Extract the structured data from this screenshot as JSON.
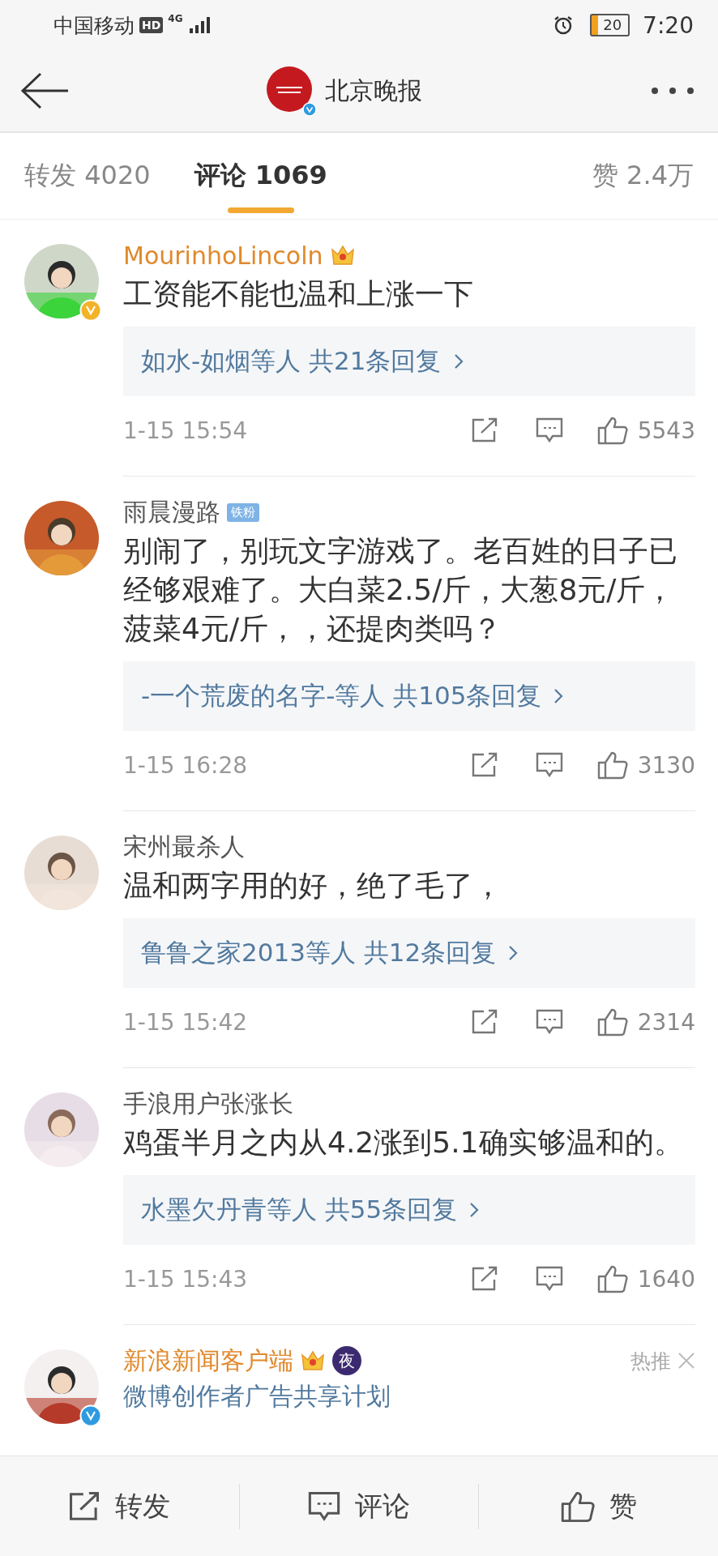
{
  "status_bar": {
    "carrier": "中国移动",
    "hd": "HD",
    "network": "4G",
    "battery": "20",
    "time": "7:20"
  },
  "header": {
    "title": "北京晚报"
  },
  "tabs": [
    {
      "label": "转发 4020",
      "selected": false
    },
    {
      "label": "评论 1069",
      "selected": true
    },
    {
      "label": "赞 2.4万",
      "selected": false
    }
  ],
  "comments": [
    {
      "name": "MourinhoLincoln",
      "vip": true,
      "verified": {
        "color": "#f2b32a"
      },
      "badges": [
        {
          "kind": "crown"
        }
      ],
      "text": "工资能不能也温和上涨一下",
      "replies": "如水-如烟等人 共21条回复",
      "time": "1-15 15:54",
      "likes": "5543"
    },
    {
      "name": "雨晨漫路",
      "vip": false,
      "badges": [
        {
          "kind": "fan",
          "text": "铁粉"
        }
      ],
      "text": "别闹了，别玩文字游戏了。老百姓的日子已经够艰难了。大白菜2.5/斤，大葱8元/斤，菠菜4元/斤，，还提肉类吗？",
      "replies": "-一个荒废的名字-等人 共105条回复",
      "time": "1-15 16:28",
      "likes": "3130"
    },
    {
      "name": "宋州最杀人",
      "vip": false,
      "text": "温和两字用的好，绝了毛了，",
      "replies": "鲁鲁之家2013等人 共12条回复",
      "time": "1-15 15:42",
      "likes": "2314"
    },
    {
      "name": "手浪用户张涨长",
      "vip": false,
      "text": "鸡蛋半月之内从4.2涨到5.1确实够温和的。",
      "replies": "水墨欠丹青等人 共55条回复",
      "time": "1-15 15:43",
      "likes": "1640"
    },
    {
      "name": "新浪新闻客户端",
      "vip": true,
      "verified": {
        "color": "#2e9be0"
      },
      "badges": [
        {
          "kind": "crown"
        },
        {
          "kind": "night",
          "text": "夜"
        }
      ],
      "subtitle": "微博创作者广告共享计划",
      "tag": "热推"
    }
  ],
  "bottom_bar": [
    {
      "kind": "share",
      "label": "转发"
    },
    {
      "kind": "comment",
      "label": "评论"
    },
    {
      "kind": "like",
      "label": "赞"
    }
  ]
}
